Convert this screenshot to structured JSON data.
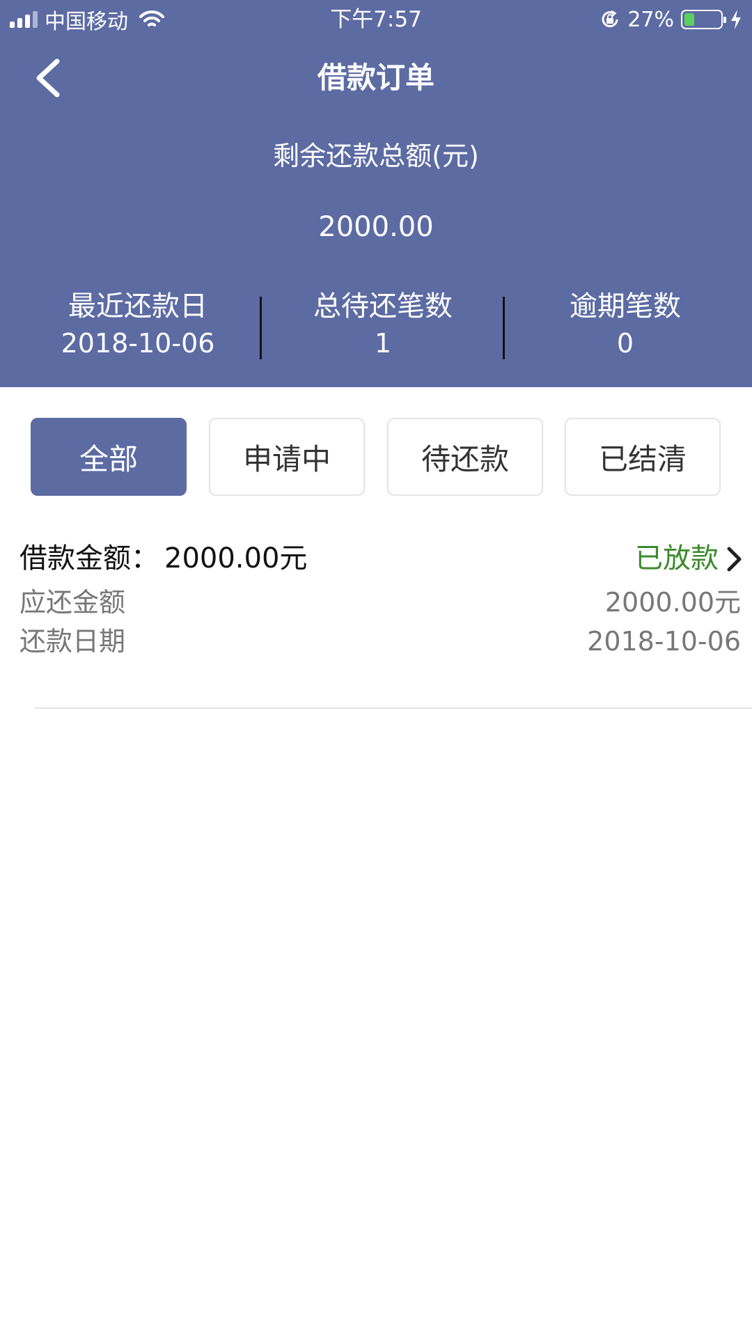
{
  "status_bar": {
    "carrier": "中国移动",
    "time": "下午7:57",
    "battery_percent": "27%",
    "battery_level": 0.27,
    "battery_color": "#5cd05c"
  },
  "nav": {
    "title": "借款订单",
    "back_icon": "chevron-left-icon"
  },
  "summary": {
    "remaining_label": "剩余还款总额(元)",
    "remaining_amount": "2000.00",
    "stats": [
      {
        "label": "最近还款日",
        "value": "2018-10-06"
      },
      {
        "label": "总待还笔数",
        "value": "1"
      },
      {
        "label": "逾期笔数",
        "value": "0"
      }
    ]
  },
  "tabs": [
    {
      "label": "全部",
      "active": true
    },
    {
      "label": "申请中",
      "active": false
    },
    {
      "label": "待还款",
      "active": false
    },
    {
      "label": "已结清",
      "active": false
    }
  ],
  "orders": [
    {
      "loan_label": "借款金额：",
      "loan_amount": "2000.00元",
      "status": "已放款",
      "due_label": "应还金额",
      "due_amount": "2000.00元",
      "date_label": "还款日期",
      "date_value": "2018-10-06"
    }
  ],
  "colors": {
    "header": "#5d6ba3",
    "status_green": "#3c8a2c",
    "muted_text": "#777777"
  }
}
